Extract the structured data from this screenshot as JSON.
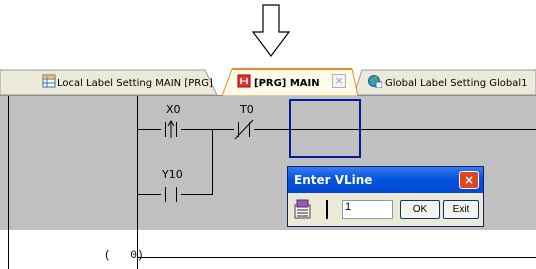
{
  "arrow": {
    "icon": "down-arrow-icon"
  },
  "tabs": [
    {
      "label": "Local Label Setting MAIN [PRG]",
      "icon": "label-table-icon",
      "active": false
    },
    {
      "label": "[PRG] MAIN",
      "icon": "ladder-program-icon",
      "active": true,
      "close_label": "×"
    },
    {
      "label": "Global Label Setting Global1",
      "icon": "global-label-icon",
      "active": false
    }
  ],
  "ladder": {
    "contacts": [
      {
        "device": "X0",
        "type": "rising-edge-contact"
      },
      {
        "device": "T0",
        "type": "normally-closed-contact"
      },
      {
        "device": "Y10",
        "type": "normally-open-contact"
      }
    ],
    "step_label": "(   0)"
  },
  "dialog": {
    "title": "Enter VLine",
    "close_label": "×",
    "tool_icon": "edit-mode-icon",
    "vline_icon": "vertical-line-icon",
    "input_value": "1",
    "ok_label": "OK",
    "exit_label": "Exit"
  },
  "colors": {
    "ladder_background": "#c0c0c0",
    "cursor_border": "#001c9c",
    "title_bar": "#0454e0",
    "close_button": "#d9481f"
  }
}
